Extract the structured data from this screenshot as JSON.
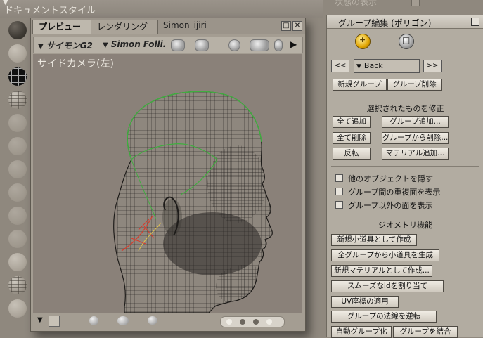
{
  "document": {
    "header_title": "ドキュメントスタイル",
    "bg_hint": "状態の表示"
  },
  "style_spheres": [
    "dark",
    "flat",
    "wire",
    "grid",
    "flat",
    "flat",
    "flat",
    "flat",
    "flat",
    "flat",
    "flat",
    "grid",
    "flat"
  ],
  "preview_window": {
    "tabs": [
      {
        "label": "プレビュー"
      },
      {
        "label": "レンダリング"
      }
    ],
    "doc_title": "Simon_ijiri",
    "figure_dropdown": "サイモンG2",
    "part_dropdown": "Simon Folli.",
    "camera_label": "サイドカメラ(左)"
  },
  "group_panel": {
    "title": "グループ編集 (ポリゴン)",
    "prev_button": "<<",
    "next_button": ">>",
    "group_selected": "Back",
    "new_group": "新規グループ",
    "delete_group": "グループ削除",
    "modify_section_label": "選択されたものを修正",
    "add_all": "全て追加",
    "add_group": "グループ追加...",
    "remove_all": "全て削除",
    "remove_from_group": "グループから削除...",
    "invert": "反転",
    "add_material": "マテリアル追加...",
    "options": [
      {
        "label": "他のオブジェクトを隠す",
        "checked": false
      },
      {
        "label": "グループ間の重複面を表示",
        "checked": false
      },
      {
        "label": "グループ以外の面を表示",
        "checked": false
      }
    ],
    "geometry_section_label": "ジオメトリ機能",
    "create_new_prop": "新規小道具として作成",
    "props_from_all_groups": "全グループから小道具を生成",
    "create_new_material": "新規マテリアルとして作成...",
    "assign_smoothing_ids": "スムーズなIdを割り当て",
    "apply_uv_coords": "UV座標の適用",
    "reverse_group_normals": "グループの法線を逆転",
    "auto_group": "自動グループ化",
    "merge_groups": "グループを結合"
  },
  "colors": {
    "mesh_line": "#1e1c1a",
    "group_outline": "#3fae3f",
    "selection_red": "#d93a2a",
    "panel_bg": "#b2aca1"
  }
}
